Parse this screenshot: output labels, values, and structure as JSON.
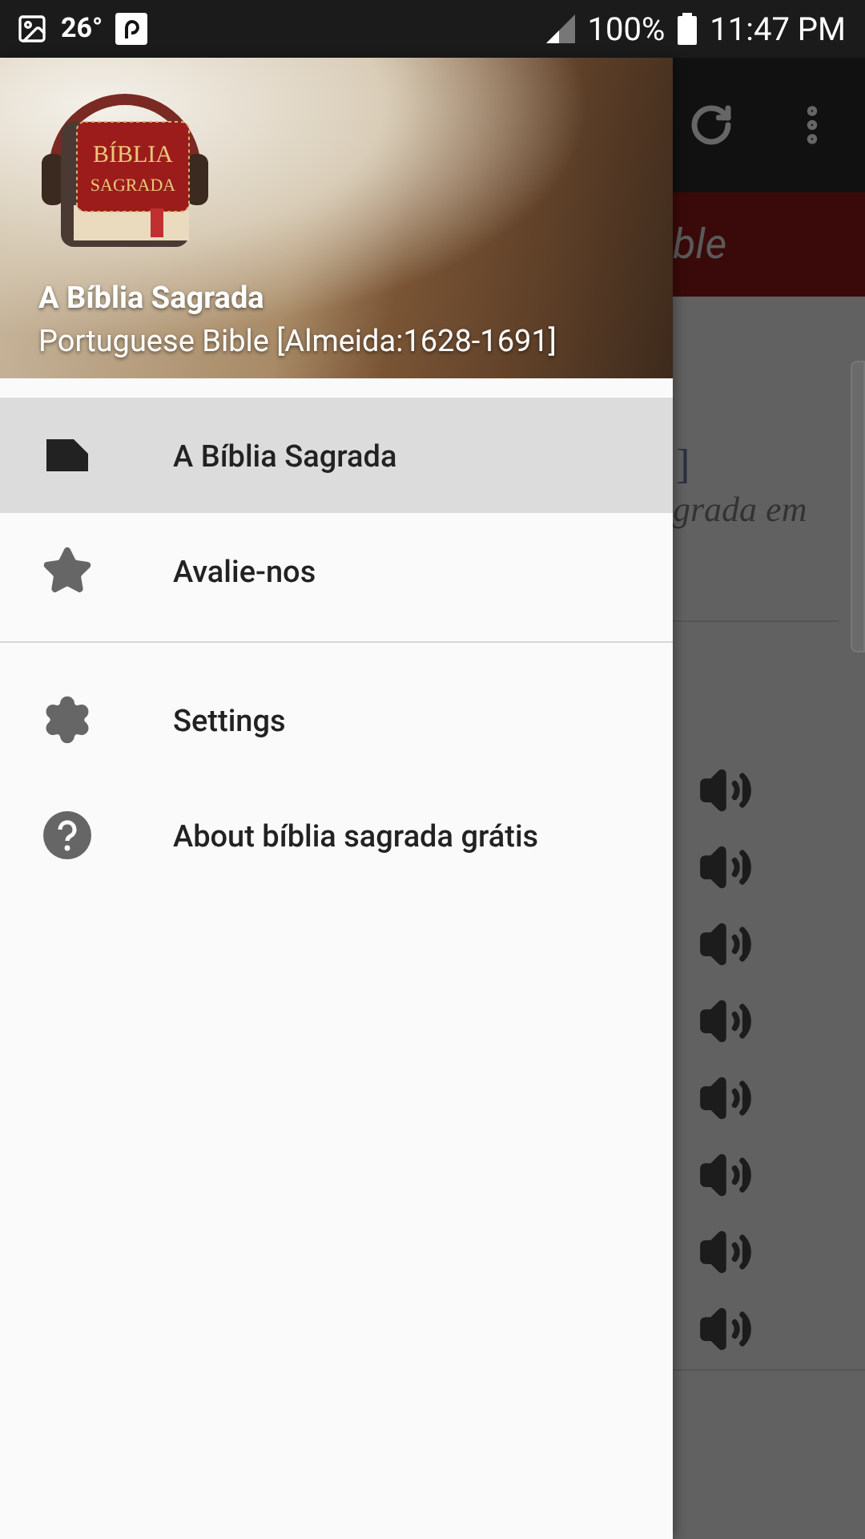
{
  "status_bar": {
    "temperature": "26°",
    "battery": "100%",
    "time": "11:47 PM"
  },
  "background_app": {
    "title_fragment": "ble",
    "text_fragments": [
      "]",
      "grada em"
    ]
  },
  "drawer": {
    "header": {
      "logo_lines": [
        "BÍBLIA",
        "SAGRADA"
      ],
      "title": "A Bíblia Sagrada",
      "subtitle": "Portuguese Bible [Almeida:1628-1691]"
    },
    "items": [
      {
        "label": "A Bíblia Sagrada",
        "kind": "book",
        "selected": true
      },
      {
        "label": "Avalie-nos",
        "kind": "star",
        "selected": false
      }
    ],
    "secondary_items": [
      {
        "label": "Settings",
        "kind": "gear",
        "selected": false
      },
      {
        "label": "About bíblia sagrada grátis",
        "kind": "help",
        "selected": false
      }
    ]
  }
}
